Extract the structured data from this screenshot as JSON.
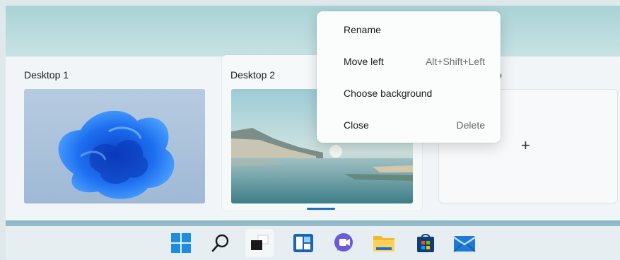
{
  "desktops": [
    {
      "title": "Desktop 1"
    },
    {
      "title": "Desktop 2",
      "active": true
    },
    {
      "title": "New desktop",
      "partial_title": "p"
    }
  ],
  "new_desktop": {
    "icon": "plus-icon",
    "symbol": "+"
  },
  "context_menu": {
    "items": [
      {
        "label": "Rename",
        "shortcut": ""
      },
      {
        "label": "Move left",
        "shortcut": "Alt+Shift+Left"
      },
      {
        "label": "Choose background",
        "shortcut": ""
      },
      {
        "label": "Close",
        "shortcut": "Delete"
      }
    ]
  },
  "taskbar": {
    "icons": [
      {
        "name": "start-icon"
      },
      {
        "name": "search-icon"
      },
      {
        "name": "task-view-icon",
        "active": true
      },
      {
        "name": "widgets-icon"
      },
      {
        "name": "chat-icon"
      },
      {
        "name": "file-explorer-icon"
      },
      {
        "name": "store-icon"
      },
      {
        "name": "mail-icon"
      }
    ]
  },
  "colors": {
    "accent": "#1f6fc4",
    "menu_bg": "#fbfcfc",
    "panel_bg": "#eef4f6"
  }
}
